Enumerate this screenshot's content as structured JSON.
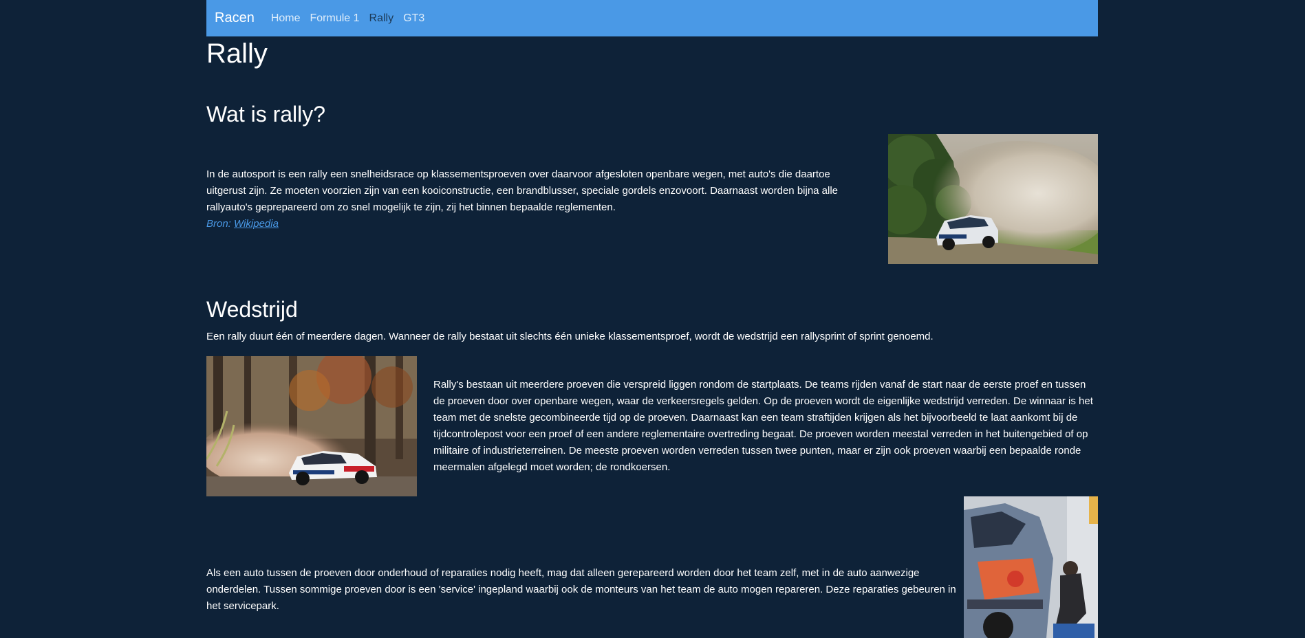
{
  "navbar": {
    "brand": "Racen",
    "links": [
      {
        "label": "Home"
      },
      {
        "label": "Formule 1"
      },
      {
        "label": "Rally"
      },
      {
        "label": "GT3"
      }
    ],
    "active": "Rally"
  },
  "page": {
    "title": "Rally"
  },
  "section_what": {
    "heading": "Wat is rally?",
    "text": "In de autosport is een rally een snelheidsrace op klassementsproeven over daarvoor afgesloten openbare wegen, met auto's die daartoe uitgerust zijn. Ze moeten voorzien zijn van een kooiconstructie, een brandblusser, speciale gordels enzovoort. Daarnaast worden bijna alle rallyauto's geprepareerd om zo snel mogelijk te zijn, zij het binnen bepaalde reglementen.",
    "source_prefix": "Bron: ",
    "source_link": "Wikipedia"
  },
  "section_race": {
    "heading": "Wedstrijd",
    "intro": "Een rally duurt één of meerdere dagen. Wanneer de rally bestaat uit slechts één unieke klassementsproef, wordt de wedstrijd een rallysprint of sprint genoemd.",
    "text1": "Rally's bestaan uit meerdere proeven die verspreid liggen rondom de startplaats. De teams rijden vanaf de start naar de eerste proef en tussen de proeven door over openbare wegen, waar de verkeersregels gelden. Op de proeven wordt de eigenlijke wedstrijd verreden. De winnaar is het team met de snelste gecombineerde tijd op de proeven. Daarnaast kan een team straftijden krijgen als het bijvoorbeeld te laat aankomt bij de tijdcontrolepost voor een proef of een andere reglementaire overtreding begaat. De proeven worden meestal verreden in het buitengebied of op militaire of industrieterreinen. De meeste proeven worden verreden tussen twee punten, maar er zijn ook proeven waarbij een bepaalde ronde meermalen afgelegd moet worden; de rondkoersen.",
    "text2": "Als een auto tussen de proeven door onderhoud of reparaties nodig heeft, mag dat alleen gerepareerd worden door het team zelf, met in de auto aanwezige onderdelen. Tussen sommige proeven door is een 'service' ingepland waarbij ook de monteurs van het team de auto mogen repareren. Deze reparaties gebeuren in het servicepark."
  },
  "colors": {
    "background": "#0e2238",
    "navbar": "#4a99e6",
    "link": "#4a99e6"
  }
}
